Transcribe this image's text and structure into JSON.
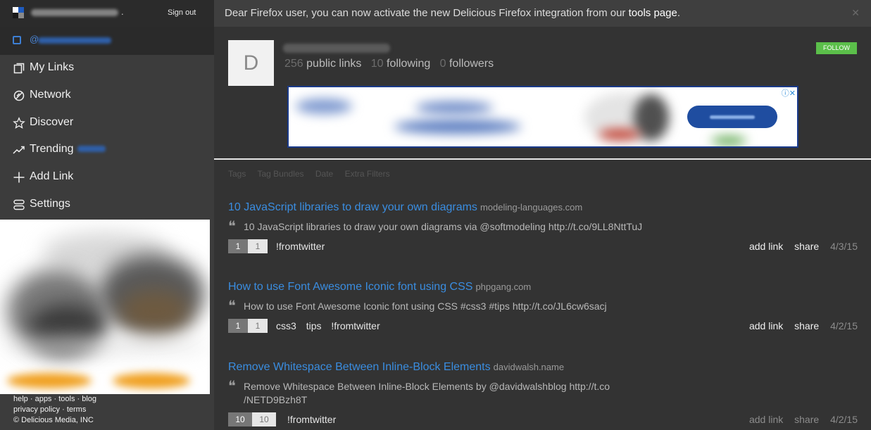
{
  "header": {
    "sign_out": "Sign out"
  },
  "sidebar": {
    "account_prefix": "@",
    "items": [
      {
        "label": "My Links",
        "icon": "links-icon"
      },
      {
        "label": "Network",
        "icon": "network-icon"
      },
      {
        "label": "Discover",
        "icon": "star-icon"
      },
      {
        "label": "Trending",
        "icon": "trending-icon"
      },
      {
        "label": "Add Link",
        "icon": "plus-icon"
      },
      {
        "label": "Settings",
        "icon": "settings-icon"
      }
    ],
    "footer": {
      "links": [
        "help",
        "apps",
        "tools",
        "blog",
        "privacy policy",
        "terms"
      ],
      "copyright": "© Delicious Media, INC"
    }
  },
  "notice": {
    "text": "Dear Firefox user, you can now activate the new Delicious Firefox integration from our ",
    "link": "tools page",
    "end": "."
  },
  "profile": {
    "avatar_letter": "D",
    "public_links_count": "256",
    "public_links_label": "public links",
    "following_count": "10",
    "following_label": "following",
    "followers_count": "0",
    "followers_label": "followers",
    "follow_button": "FOLLOW"
  },
  "filters": [
    "Tags",
    "Tag Bundles",
    "Date",
    "Extra Filters"
  ],
  "links": [
    {
      "title": "10 JavaScript libraries to draw your own diagrams",
      "domain": "modeling-languages.com",
      "quote": "10 JavaScript libraries to draw your own diagrams via @softmodeling http://t.co/9LL8NttTuJ",
      "count_a": "1",
      "count_b": "1",
      "tags": [
        "!fromtwitter"
      ],
      "add_link": "add link",
      "share": "share",
      "date": "4/3/15"
    },
    {
      "title": "How to use Font Awesome Iconic font using CSS",
      "domain": "phpgang.com",
      "quote": "How to use Font Awesome Iconic font using CSS #css3 #tips http://t.co/JL6cw6sacj",
      "count_a": "1",
      "count_b": "1",
      "tags": [
        "css3",
        "tips",
        "!fromtwitter"
      ],
      "add_link": "add link",
      "share": "share",
      "date": "4/2/15"
    },
    {
      "title": "Remove Whitespace Between Inline-Block Elements",
      "domain": "davidwalsh.name",
      "quote": "Remove Whitespace Between Inline-Block Elements by @davidwalshblog http://t.co /NETD9Bzh8T",
      "count_a": "10",
      "count_b": "10",
      "tags": [
        "!fromtwitter"
      ],
      "add_link": "add link",
      "share": "share",
      "date": "4/2/15"
    }
  ],
  "colors": {
    "accent_link": "#3a8de0",
    "follow_green": "#5bbf4a",
    "sidebar_bg": "#3c3c3c",
    "main_bg": "#333333"
  }
}
